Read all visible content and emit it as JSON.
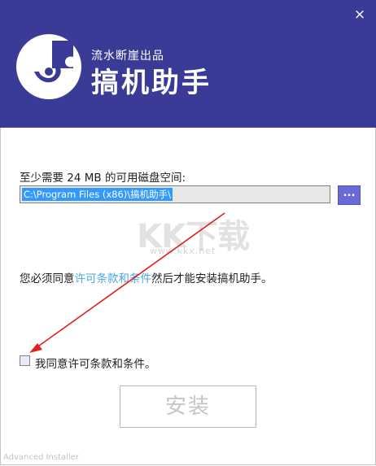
{
  "window": {
    "close_icon": "×",
    "subtitle": "流水断崖出品",
    "title": "搞机助手"
  },
  "install": {
    "space_label": "至少需要 24 MB 的可用磁盘空间:",
    "path_value": "C:\\Program Files (x86)\\搞机助手\\",
    "browse_label": "...",
    "license_prefix": "您必须同意",
    "license_link": "许可条款和条件",
    "license_suffix": "然后才能安装搞机助手。",
    "agree_label": "我同意许可条款和条件。",
    "agree_checked": false,
    "install_button": "安装"
  },
  "watermark": {
    "logo_text": "KK下载",
    "url": "www.kkx.net"
  },
  "footer": {
    "text": "Advanced Installer"
  },
  "colors": {
    "header_bg": "#3a3b96",
    "link": "#4da6e0",
    "browse_bg": "#6a6ad6",
    "annotation_arrow": "#e0201c"
  }
}
